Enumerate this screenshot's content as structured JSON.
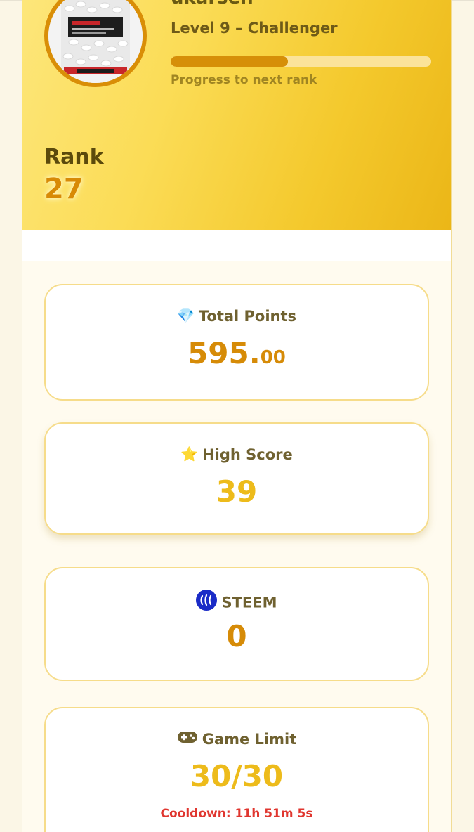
{
  "profile": {
    "username": "ukarsen",
    "level": "Level 9 – Challenger",
    "progress_fraction": 0.45,
    "progress_label": "Progress to next rank",
    "rank_label": "Rank",
    "rank_value": "27",
    "avatar_icon": "avatar-photo"
  },
  "stats": {
    "total_points": {
      "icon": "gem-icon",
      "icon_glyph": "💎",
      "label": "Total Points",
      "value_int": "595.",
      "value_dec": "00"
    },
    "high_score": {
      "icon": "star-icon",
      "icon_glyph": "⭐",
      "label": "High Score",
      "value": "39"
    },
    "steem": {
      "icon": "steem-icon",
      "label": "STEEM",
      "value": "0"
    },
    "game_limit": {
      "icon": "gamepad-icon",
      "label": "Game Limit",
      "value": "30/30",
      "cooldown": "Cooldown: 11h 51m 5s"
    }
  },
  "colors": {
    "accent_orange": "#d68b07",
    "accent_yellow": "#edbb1b",
    "card_border": "#f6dc8a",
    "cooldown_red": "#e0362f",
    "steem_blue": "#1a2bc7"
  }
}
